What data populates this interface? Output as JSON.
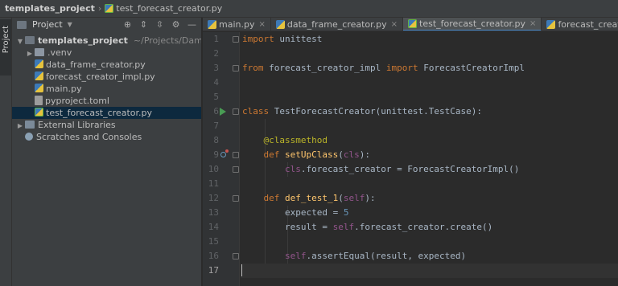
{
  "breadcrumb": {
    "project": "templates_project",
    "file": "test_forecast_creator.py"
  },
  "side_stripe": {
    "label": "Project"
  },
  "project_panel": {
    "title": "Project",
    "tools": [
      "target-icon",
      "expand-all-icon",
      "collapse-all-icon",
      "gear-icon",
      "hide-icon"
    ],
    "tree": [
      {
        "label": "templates_project",
        "path": "~/Projects/Damavis/Pos",
        "type": "root-folder"
      },
      {
        "label": ".venv",
        "type": "folder"
      },
      {
        "label": "data_frame_creator.py",
        "type": "python-file"
      },
      {
        "label": "forecast_creator_impl.py",
        "type": "python-file"
      },
      {
        "label": "main.py",
        "type": "python-file"
      },
      {
        "label": "pyproject.toml",
        "type": "toml-file"
      },
      {
        "label": "test_forecast_creator.py",
        "type": "python-test-file",
        "selected": true
      },
      {
        "label": "External Libraries",
        "type": "library"
      },
      {
        "label": "Scratches and Consoles",
        "type": "scratches"
      }
    ]
  },
  "tabs": [
    {
      "label": "main.py",
      "active": false
    },
    {
      "label": "data_frame_creator.py",
      "active": false
    },
    {
      "label": "test_forecast_creator.py",
      "active": true
    },
    {
      "label": "forecast_creator_impl.py",
      "active": false
    }
  ],
  "editor": {
    "current_line": 17,
    "lines": [
      {
        "n": "1",
        "text": "import unittest"
      },
      {
        "n": "2",
        "text": ""
      },
      {
        "n": "3",
        "text": "from forecast_creator_impl import ForecastCreatorImpl"
      },
      {
        "n": "4",
        "text": ""
      },
      {
        "n": "5",
        "text": ""
      },
      {
        "n": "6",
        "text": "class TestForecastCreator(unittest.TestCase):"
      },
      {
        "n": "7",
        "text": ""
      },
      {
        "n": "8",
        "text": "    @classmethod"
      },
      {
        "n": "9",
        "text": "    def setUpClass(cls):"
      },
      {
        "n": "10",
        "text": "        cls.forecast_creator = ForecastCreatorImpl()"
      },
      {
        "n": "11",
        "text": ""
      },
      {
        "n": "12",
        "text": "    def def_test_1(self):"
      },
      {
        "n": "13",
        "text": "        expected = 5"
      },
      {
        "n": "14",
        "text": "        result = self.forecast_creator.create()"
      },
      {
        "n": "15",
        "text": ""
      },
      {
        "n": "16",
        "text": "        self.assertEqual(result, expected)"
      },
      {
        "n": "17",
        "text": ""
      }
    ]
  },
  "colors": {
    "keyword": "#cc7832",
    "decorator": "#bbb529",
    "function": "#ffc66d",
    "number": "#6897bb",
    "self": "#94558d",
    "text": "#a9b7c6",
    "accent": "#4a88c7"
  }
}
